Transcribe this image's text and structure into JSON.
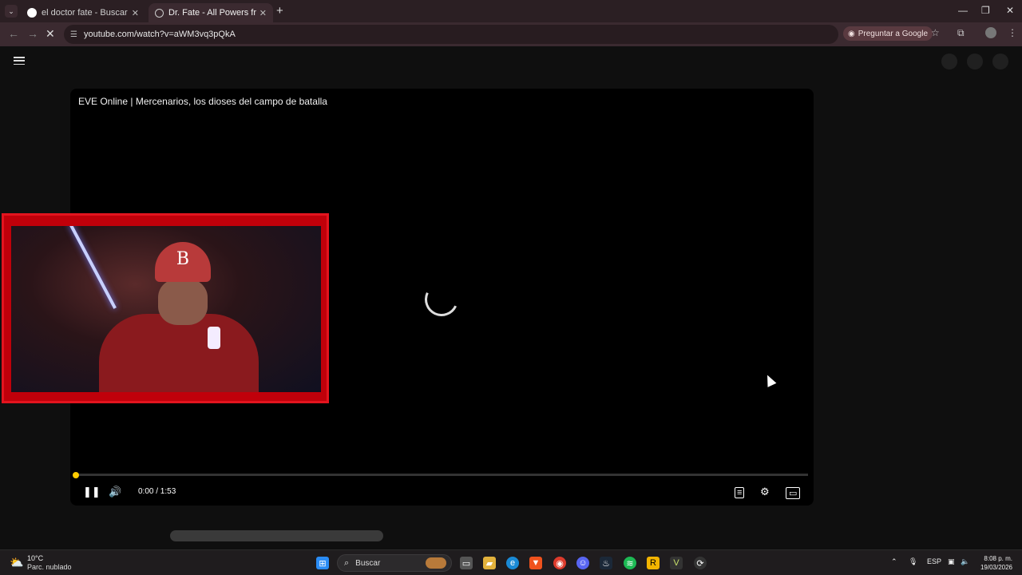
{
  "browser": {
    "tabs": [
      {
        "title": "el doctor fate - Buscar con Goo",
        "active": false
      },
      {
        "title": "Dr. Fate - All Powers from Black",
        "active": true
      }
    ],
    "url": "youtube.com/watch?v=aWM3vq3pQkA",
    "ask_google": "Preguntar a Google"
  },
  "player": {
    "title": "EVE Online | Mercenarios, los dioses del campo de batalla",
    "time": "0:00 / 1:53",
    "progress": 0.0
  },
  "taskbar": {
    "temperature": "10°C",
    "condition": "Parc. nublado",
    "search_placeholder": "Buscar",
    "language": "ESP",
    "clock_time": "8:08 p. m.",
    "clock_date": "19/03/2026"
  },
  "colors": {
    "accent": "#ffcc00",
    "webcam_frame": "#e3141e"
  }
}
